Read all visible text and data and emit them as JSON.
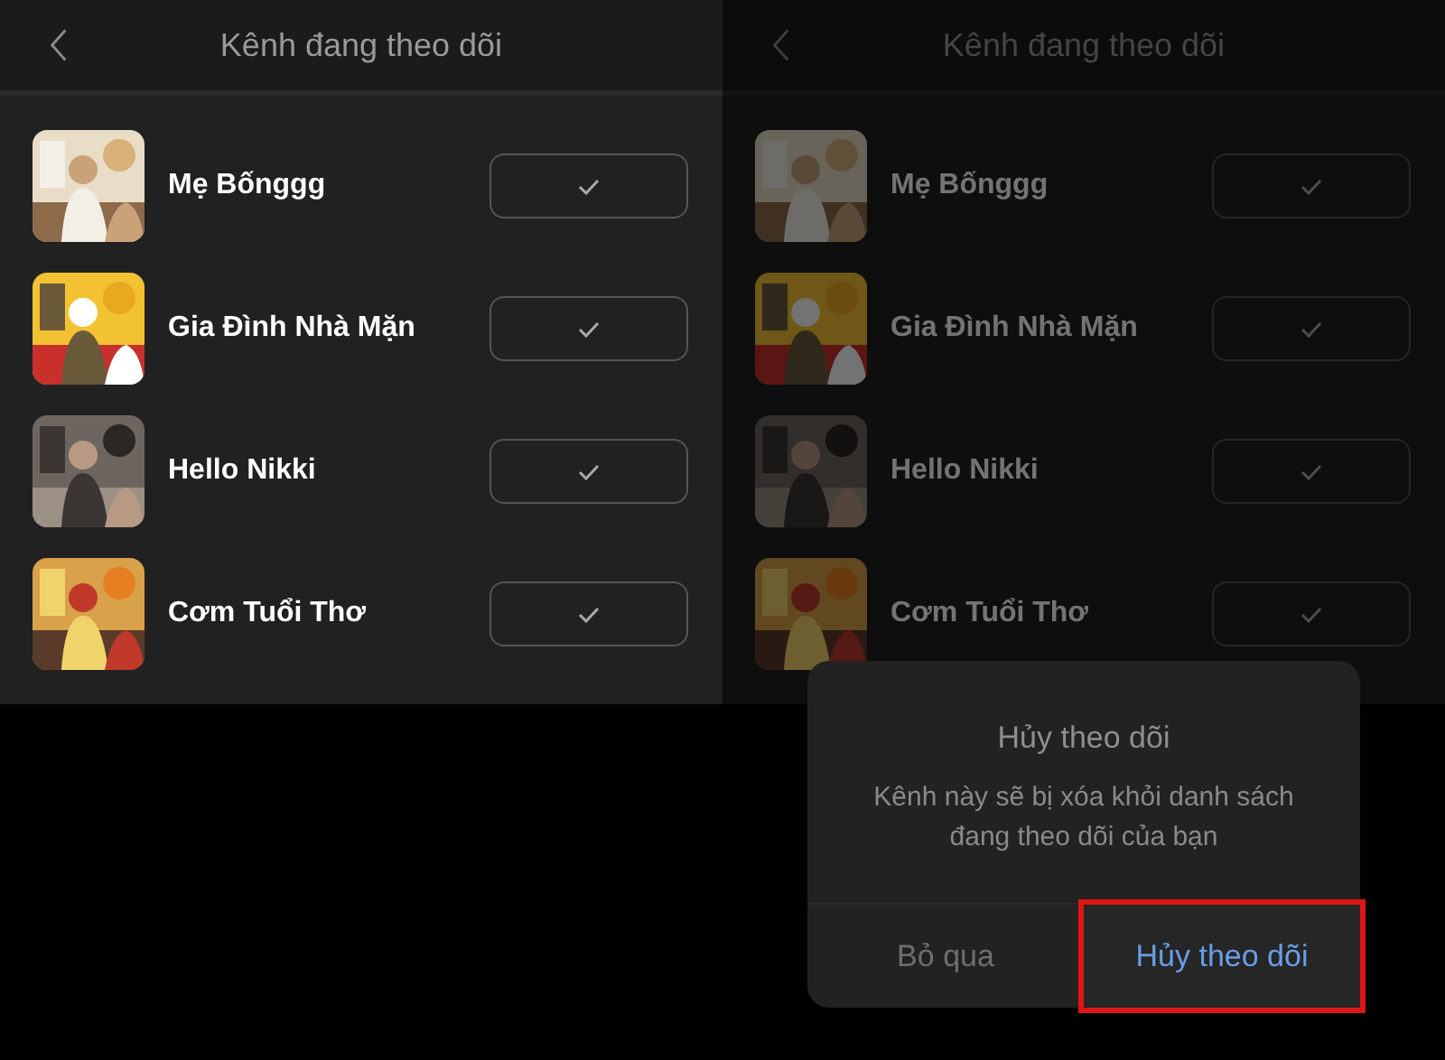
{
  "screens": [
    {
      "title": "Kênh đang theo dõi",
      "dimmed": false,
      "channels": [
        {
          "name": "Mẹ Bốnggg",
          "following": true
        },
        {
          "name": "Gia Đình Nhà Mặn",
          "following": true
        },
        {
          "name": "Hello Nikki",
          "following": true
        },
        {
          "name": "Cơm Tuổi Thơ",
          "following": true
        }
      ]
    },
    {
      "title": "Kênh đang theo dõi",
      "dimmed": true,
      "channels": [
        {
          "name": "Mẹ Bốnggg",
          "following": true
        },
        {
          "name": "Gia Đình Nhà Mặn",
          "following": true
        },
        {
          "name": "Hello Nikki",
          "following": true
        },
        {
          "name": "Cơm Tuổi Thơ",
          "following": true
        }
      ],
      "dialog": {
        "title": "Hủy theo dõi",
        "message": "Kênh này sẽ bị xóa khỏi danh sách đang theo dõi của bạn",
        "buttons": [
          {
            "label": "Bỏ qua",
            "kind": "cancel",
            "highlighted": false
          },
          {
            "label": "Hủy theo dõi",
            "kind": "confirm",
            "highlighted": true
          }
        ]
      }
    }
  ]
}
